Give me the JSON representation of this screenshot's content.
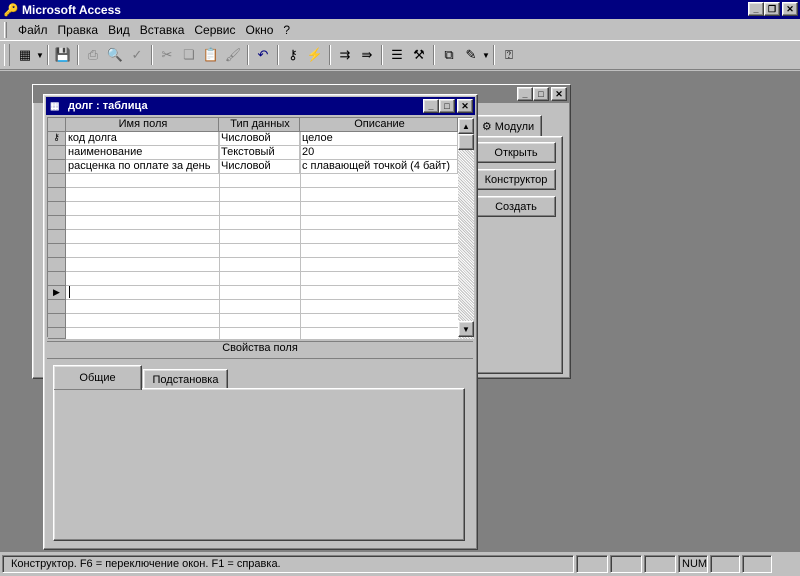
{
  "app": {
    "title": "Microsoft Access"
  },
  "menu": [
    "Файл",
    "Правка",
    "Вид",
    "Вставка",
    "Сервис",
    "Окно",
    "?"
  ],
  "db_window": {
    "tab_modules": "Модули",
    "buttons": {
      "open": "Открыть",
      "design": "Конструктор",
      "create": "Создать"
    }
  },
  "table_window": {
    "title": "долг : таблица",
    "columns": [
      "Имя поля",
      "Тип данных",
      "Описание"
    ],
    "rows": [
      [
        "код долга",
        "Числовой",
        "целое"
      ],
      [
        "наименование",
        "Текстовый",
        "20"
      ],
      [
        "расценка по оплате за день",
        "Числовой",
        "с плавающей точкой (4 байт)"
      ]
    ],
    "properties_label": "Свойства поля",
    "tabs": {
      "general": "Общие",
      "lookup": "Подстановка"
    }
  },
  "statusbar": {
    "text": "Конструктор.  F6 = переключение окон.  F1 = справка.",
    "num": "NUM"
  },
  "icons": {
    "app": "key-icon",
    "key_row": "primary-key-icon",
    "current_row": "row-pointer-icon"
  },
  "colors": {
    "titlebar_active": "#000080",
    "titlebar_inactive": "#808080",
    "face": "#c0c0c0",
    "mdi": "#808080"
  }
}
